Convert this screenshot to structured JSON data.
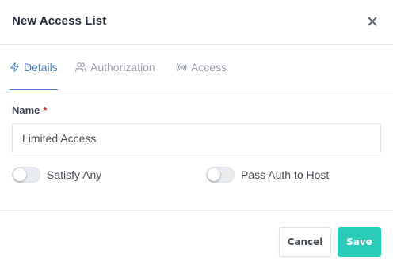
{
  "modal": {
    "title": "New Access List"
  },
  "tabs": [
    {
      "label": "Details",
      "icon": "bolt-icon",
      "active": true
    },
    {
      "label": "Authorization",
      "icon": "users-icon",
      "active": false
    },
    {
      "label": "Access",
      "icon": "radio-icon",
      "active": false
    }
  ],
  "form": {
    "name_label": "Name",
    "required_mark": "*",
    "name_value": "Limited Access",
    "toggles": [
      {
        "label": "Satisfy Any",
        "on": false
      },
      {
        "label": "Pass Auth to Host",
        "on": false
      }
    ]
  },
  "footer": {
    "cancel_label": "Cancel",
    "save_label": "Save"
  },
  "colors": {
    "accent": "#467fcf",
    "save": "#2bcbba",
    "required": "#cd201f"
  }
}
